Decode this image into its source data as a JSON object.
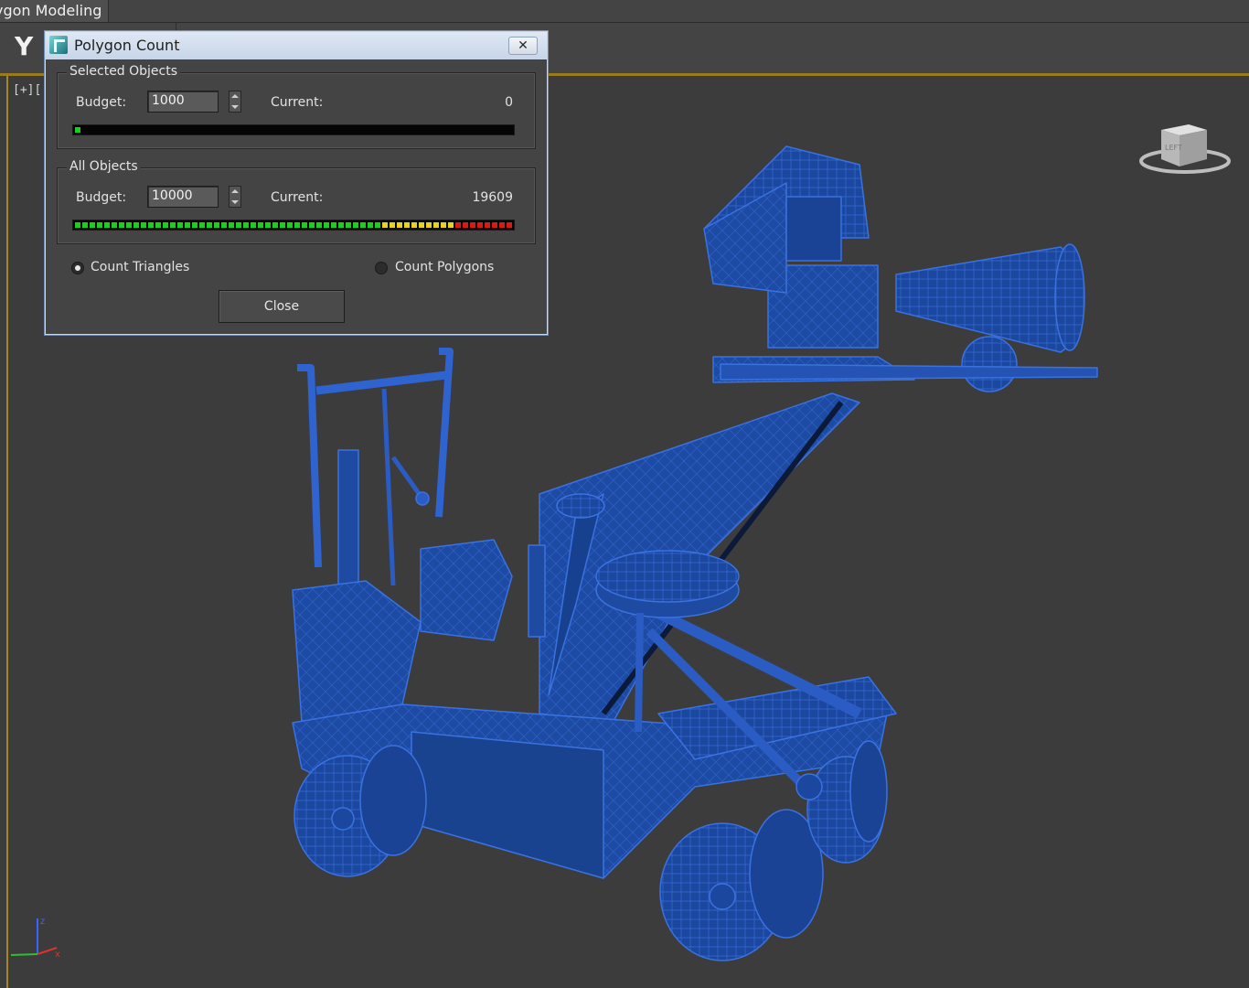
{
  "ribbon": {
    "tab_label": "ygon Modeling"
  },
  "viewport": {
    "label": "[+]["
  },
  "dialog": {
    "title": "Polygon Count",
    "close_glyph": "✕",
    "selected_objects": {
      "group_label": "Selected Objects",
      "budget_label": "Budget:",
      "budget_value": "1000",
      "current_label": "Current:",
      "current_value": "0",
      "meter_fill_fraction": 0.02
    },
    "all_objects": {
      "group_label": "All Objects",
      "budget_label": "Budget:",
      "budget_value": "10000",
      "current_label": "Current:",
      "current_value": "19609",
      "meter_fill_fraction": 1.0
    },
    "count_triangles_label": "Count Triangles",
    "count_polygons_label": "Count Polygons",
    "selected_mode": "Count Triangles",
    "close_button_label": "Close"
  },
  "viewcube": {
    "face_label": "LEFT"
  },
  "axes": {
    "z_label": "z",
    "x_label": "x"
  },
  "colors": {
    "model_wire": "#1f4fa8",
    "meter_green": "#19d11b",
    "meter_yellow": "#e6d31a",
    "meter_red": "#d81a12",
    "viewport_border": "#a3862a"
  },
  "icons": [
    "app-3dsmax-icon",
    "close-icon",
    "spinner-up-icon",
    "spinner-down-icon",
    "viewcube-icon",
    "axis-tripod-icon",
    "y-constraint-icon"
  ]
}
